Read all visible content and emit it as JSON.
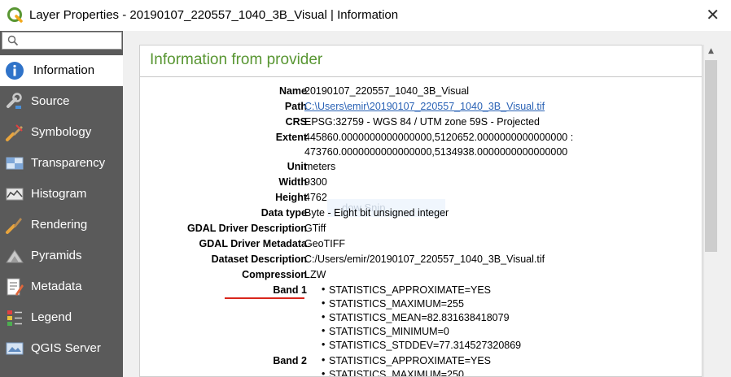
{
  "window": {
    "title": "Layer Properties - 20190107_220557_1040_3B_Visual | Information",
    "close_glyph": "✕",
    "app_icon": "qgis-logo-icon"
  },
  "sidebar": {
    "search": {
      "value": "",
      "placeholder": ""
    },
    "items": [
      {
        "label": "Information",
        "icon": "information-icon",
        "active": true
      },
      {
        "label": "Source",
        "icon": "source-wrench-icon"
      },
      {
        "label": "Symbology",
        "icon": "symbology-brush-icon"
      },
      {
        "label": "Transparency",
        "icon": "transparency-icon"
      },
      {
        "label": "Histogram",
        "icon": "histogram-icon"
      },
      {
        "label": "Rendering",
        "icon": "rendering-brush-icon"
      },
      {
        "label": "Pyramids",
        "icon": "pyramids-icon"
      },
      {
        "label": "Metadata",
        "icon": "metadata-icon"
      },
      {
        "label": "Legend",
        "icon": "legend-icon"
      },
      {
        "label": "QGIS Server",
        "icon": "qgis-server-icon"
      }
    ]
  },
  "main": {
    "header": "Information from provider",
    "fields": {
      "name": {
        "label": "Name",
        "value": "20190107_220557_1040_3B_Visual"
      },
      "path": {
        "label": "Path",
        "value": "C:\\Users\\emir\\20190107_220557_1040_3B_Visual.tif"
      },
      "crs": {
        "label": "CRS",
        "value": "EPSG:32759 - WGS 84 / UTM zone 59S - Projected"
      },
      "extent": {
        "label": "Extent",
        "value_line1": "445860.0000000000000000,5120652.0000000000000000 :",
        "value_line2": "473760.0000000000000000,5134938.0000000000000000"
      },
      "unit": {
        "label": "Unit",
        "value": "meters"
      },
      "width": {
        "label": "Width",
        "value": "9300"
      },
      "height": {
        "label": "Height",
        "value": "4762"
      },
      "data_type": {
        "label": "Data type",
        "value": "Byte - Eight bit unsigned integer"
      },
      "gdal_driver_description": {
        "label": "GDAL Driver Description",
        "value": "GTiff"
      },
      "gdal_driver_metadata": {
        "label": "GDAL Driver Metadata",
        "value": "GeoTIFF"
      },
      "dataset_description": {
        "label": "Dataset Description",
        "value": "C:/Users/emir/20190107_220557_1040_3B_Visual.tif"
      },
      "compression": {
        "label": "Compression",
        "value": "LZW"
      }
    },
    "bands": [
      {
        "label": "Band 1",
        "stats": [
          "STATISTICS_APPROXIMATE=YES",
          "STATISTICS_MAXIMUM=255",
          "STATISTICS_MEAN=82.831638418079",
          "STATISTICS_MINIMUM=0",
          "STATISTICS_STDDEV=77.314527320869"
        ]
      },
      {
        "label": "Band 2",
        "stats": [
          "STATISTICS_APPROXIMATE=YES",
          "STATISTICS_MAXIMUM=250"
        ]
      }
    ],
    "overlay_ghost_text": "dow Snip"
  },
  "colors": {
    "header_green": "#589632",
    "sidebar_bg": "#5a5a5a",
    "link_blue": "#2a62b5",
    "highlight_red": "#d9261c"
  }
}
